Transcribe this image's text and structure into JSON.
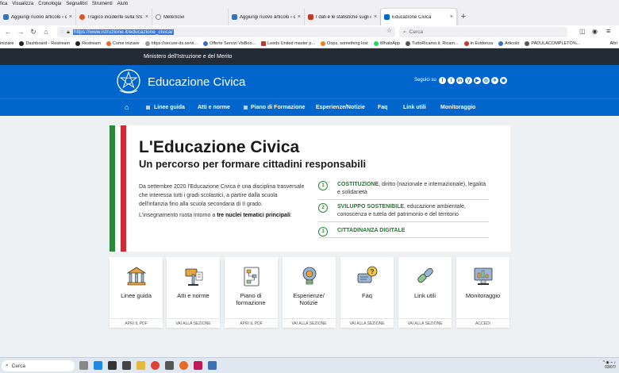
{
  "browser": {
    "menu": [
      "fica",
      "Visualizza",
      "Cronologia",
      "Segnalibri",
      "Strumenti",
      "Aiuto"
    ],
    "tabs": [
      {
        "title": "Aggiungi nuovo articolo ‹ citte...",
        "fav_color": "#3b6fb6",
        "active": false
      },
      {
        "title": "Tragico incidente sulla SS18 in ...",
        "fav_color": "#d9532a",
        "active": false
      },
      {
        "title": "MeteScivi",
        "fav_color": "#888888",
        "active": false
      },
      {
        "title": "Aggiungi nuovo articolo ‹ citte...",
        "fav_color": "#3b6fb6",
        "active": false
      },
      {
        "title": "I dati e le statistiche sugli incid...",
        "fav_color": "#c0392b",
        "active": false
      },
      {
        "title": "Educazione Civica",
        "fav_color": "#0066cc",
        "active": true
      }
    ],
    "new_tab": "+",
    "url": "https://www.istruzione.it/educazione_civica/",
    "search_placeholder": "Cerca",
    "bookmarks": [
      {
        "label": "iniziare",
        "color": "#555555"
      },
      {
        "label": "Dashboard - Restream",
        "color": "#222222"
      },
      {
        "label": "Restream",
        "color": "#222222"
      },
      {
        "label": "Come iniziare",
        "color": "#e66a2c"
      },
      {
        "label": "https://secure-ds.servi...",
        "color": "#999999"
      },
      {
        "label": "Offerte Servizi VisBoo...",
        "color": "#3b6fb6"
      },
      {
        "label": "Leeds United master p...",
        "color": "#c0392b"
      },
      {
        "label": "Oops, something lost",
        "color": "#e67e22"
      },
      {
        "label": "WhatsApp",
        "color": "#25d366"
      },
      {
        "label": "TuttoRicamo.it, Ricam...",
        "color": "#555555"
      },
      {
        "label": "in Evidenza",
        "color": "#c0392b"
      },
      {
        "label": "Articolo",
        "color": "#3b6fb6"
      },
      {
        "label": "PADULACOMPLETO%...",
        "color": "#555555"
      },
      {
        "label": "Altri",
        "color": "#555555"
      }
    ]
  },
  "site": {
    "ministry": "Ministero dell'Istruzione e del Merito",
    "title": "Educazione Civica",
    "social_label": "Seguici su",
    "social": [
      "f",
      "t",
      "in",
      "y",
      "▶",
      "◎",
      "✈",
      "◉"
    ],
    "nav": [
      "Linee guida",
      "Atti e norme",
      "Piano di Formazione",
      "Esperienze/Notizie",
      "Faq",
      "Link utili",
      "Monitoraggio"
    ],
    "hero": {
      "title": "L'Educazione Civica",
      "subtitle": "Un percorso per formare cittadini responsabili",
      "intro": "Da settembre 2020 l'Educazione Civica è una disciplina trasversale che interessa tutti i gradi scolastici, a partire dalla scuola dell'infanzia fino alla scuola secondaria di II grado.",
      "intro2_a": "L'insegnamento ruota intorno a ",
      "intro2_b": "tre nuclei tematici principali",
      "intro2_c": ":",
      "nuclei": [
        {
          "num": "1",
          "head": "COSTITUZIONE",
          "rest": ", diritto (nazionale e internazionale), legalità e solidarietà"
        },
        {
          "num": "2",
          "head": "SVILUPPO SOSTENIBILE",
          "rest": ", educazione ambientale, conoscenza e tutela del patrimonio e del territorio"
        },
        {
          "num": "3",
          "head": "CITTADINANZA DIGITALE",
          "rest": ""
        }
      ]
    },
    "cards": [
      {
        "label": "Linee guida",
        "foot": "APRI IL PDF",
        "icon": "building-icon"
      },
      {
        "label": "Atti e norme",
        "foot": "VAI ALLA SEZIONE",
        "icon": "gavel-icon"
      },
      {
        "label": "Piano di formazione",
        "foot": "APRI IL PDF",
        "icon": "plan-icon"
      },
      {
        "label": "Esperienze/ Notizie",
        "foot": "VAI ALLA SEZIONE",
        "icon": "lightbulb-icon"
      },
      {
        "label": "Faq",
        "foot": "VAI ALLA SEZIONE",
        "icon": "question-bubble-icon"
      },
      {
        "label": "Link utili",
        "foot": "VAI ALLA SEZIONE",
        "icon": "link-icon"
      },
      {
        "label": "Monitoraggio",
        "foot": "ACCEDI",
        "icon": "monitor-icon"
      }
    ]
  },
  "taskbar": {
    "search_placeholder": "Cerca",
    "time": "03/07/"
  },
  "colors": {
    "brand_blue": "#0066cc",
    "dark_bar": "#222b36",
    "flag_green": "#2a8a3a",
    "flag_red": "#ce2b37",
    "nucleo_green": "#1e7a2e"
  }
}
